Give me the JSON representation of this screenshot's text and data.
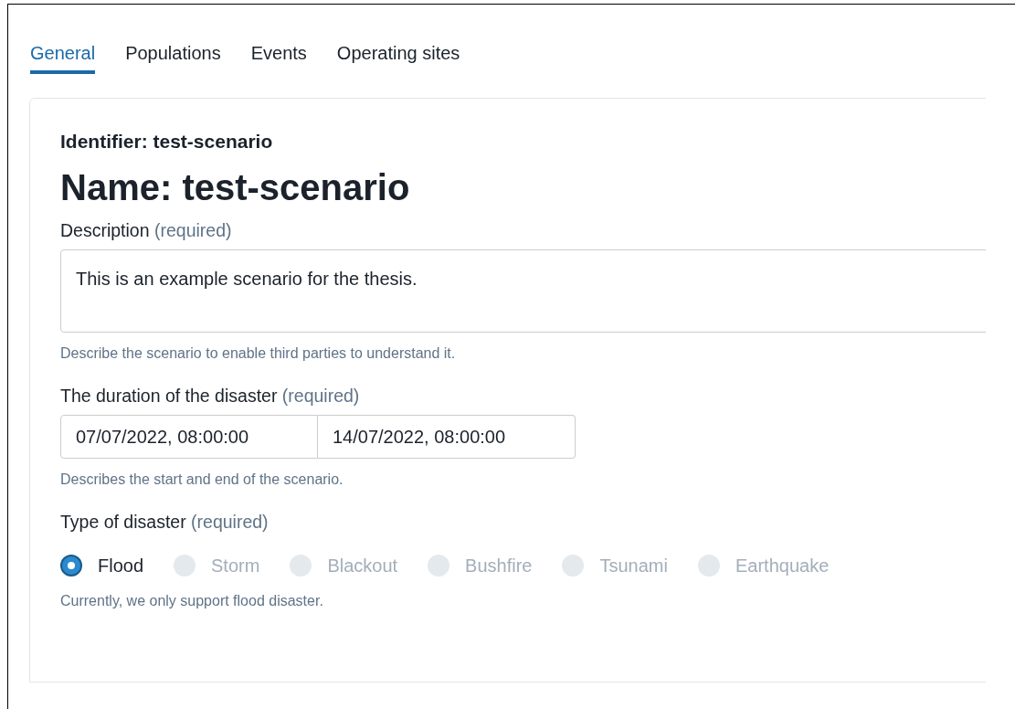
{
  "tabs": [
    {
      "label": "General",
      "selected": true
    },
    {
      "label": "Populations",
      "selected": false
    },
    {
      "label": "Events",
      "selected": false
    },
    {
      "label": "Operating sites",
      "selected": false
    }
  ],
  "identifier": "Identifier: test-scenario",
  "name": "Name: test-scenario",
  "description": {
    "label": "Description",
    "required": "(required)",
    "value": "This is an example scenario for the thesis.",
    "help": "Describe the scenario to enable third parties to understand it."
  },
  "duration": {
    "label": "The duration of the disaster",
    "required": "(required)",
    "start": "07/07/2022, 08:00:00",
    "end": "14/07/2022, 08:00:00",
    "help": "Describes the start and end of the scenario."
  },
  "disaster_type": {
    "label": "Type of disaster",
    "required": "(required)",
    "options": [
      {
        "label": "Flood",
        "selected": true,
        "disabled": false
      },
      {
        "label": "Storm",
        "selected": false,
        "disabled": true
      },
      {
        "label": "Blackout",
        "selected": false,
        "disabled": true
      },
      {
        "label": "Bushfire",
        "selected": false,
        "disabled": true
      },
      {
        "label": "Tsunami",
        "selected": false,
        "disabled": true
      },
      {
        "label": "Earthquake",
        "selected": false,
        "disabled": true
      }
    ],
    "help": "Currently, we only support flood disaster."
  }
}
